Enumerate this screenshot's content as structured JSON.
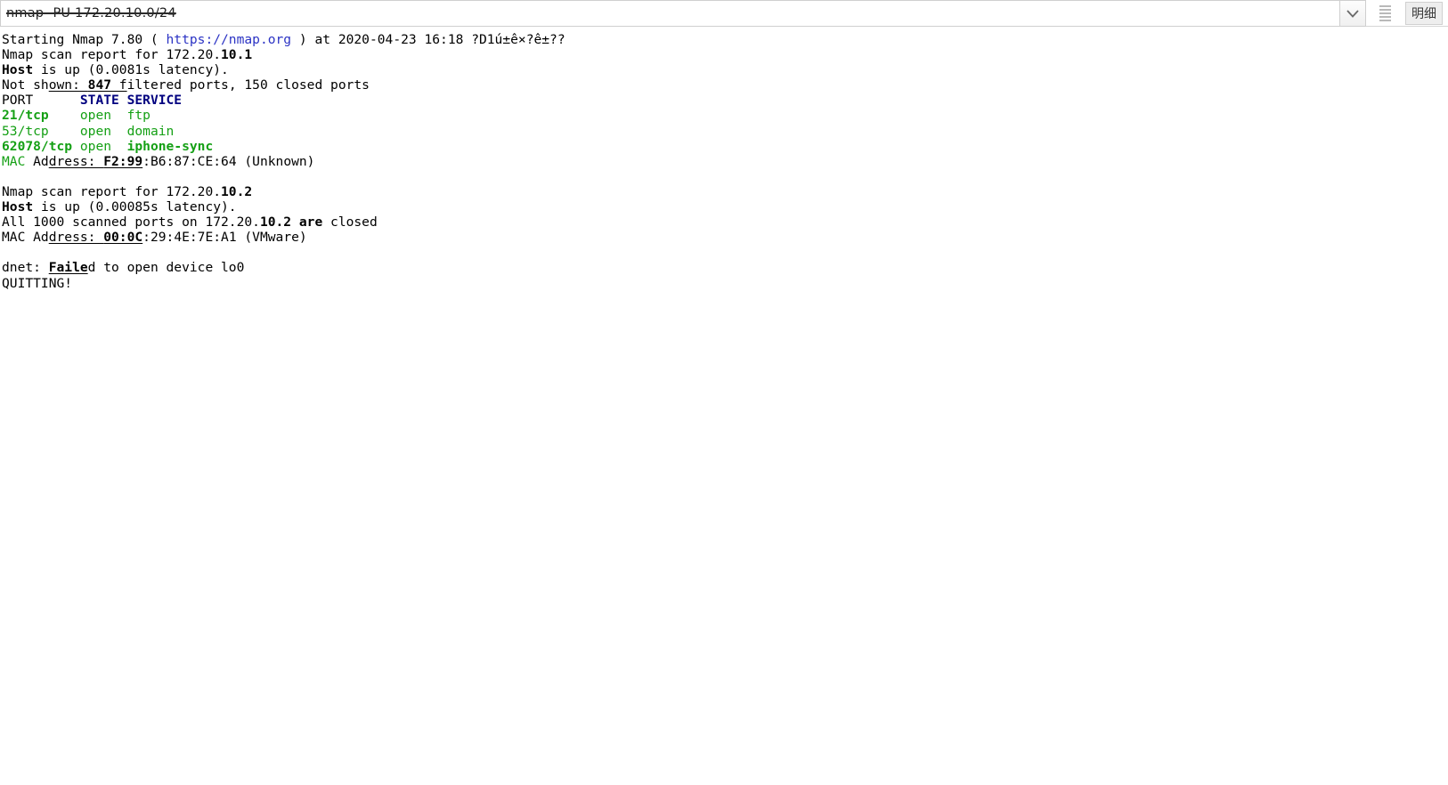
{
  "topbar": {
    "command_value": "nmap -PU 172.20.10.0/24",
    "command_placeholder": "",
    "dropdown_icon": "chevron-down-icon",
    "lines_icon": "list-lines-icon",
    "detail_button_label": "明细"
  },
  "terminal": {
    "lines": [
      {
        "id": "line-starting",
        "segments": [
          {
            "t": "Starting Nmap 7.80 ( ",
            "c": ""
          },
          {
            "t": "https://nmap.org",
            "c": "link"
          },
          {
            "t": " ) at 2020-04-23 16:18 ?D1ú±ê×?ê±??",
            "c": ""
          }
        ]
      },
      {
        "id": "line-report-1",
        "segments": [
          {
            "t": "Nmap scan report for 172.20.",
            "c": ""
          },
          {
            "t": "10.1",
            "c": "b"
          }
        ]
      },
      {
        "id": "line-host-up-1",
        "segments": [
          {
            "t": "Host",
            "c": "b"
          },
          {
            "t": " is up (0.0081s latency).",
            "c": ""
          }
        ]
      },
      {
        "id": "line-not-shown",
        "segments": [
          {
            "t": "Not sh",
            "c": ""
          },
          {
            "t": "own: ",
            "c": "u"
          },
          {
            "t": "847",
            "c": "b u"
          },
          {
            "t": " f",
            "c": "u"
          },
          {
            "t": "iltered ports, 150 closed ports",
            "c": ""
          }
        ]
      },
      {
        "id": "line-port-header",
        "segments": [
          {
            "t": "PORT      ",
            "c": ""
          },
          {
            "t": "STATE SERVICE",
            "c": "hdr"
          }
        ]
      },
      {
        "id": "line-port-21",
        "segments": [
          {
            "t": "21/tcp",
            "c": "grnb"
          },
          {
            "t": "    ",
            "c": ""
          },
          {
            "t": "open",
            "c": "grn"
          },
          {
            "t": "  ",
            "c": ""
          },
          {
            "t": "ftp",
            "c": "grn"
          }
        ]
      },
      {
        "id": "line-port-53",
        "segments": [
          {
            "t": "53/tcp",
            "c": "grn"
          },
          {
            "t": "    ",
            "c": ""
          },
          {
            "t": "open",
            "c": "grn"
          },
          {
            "t": "  ",
            "c": ""
          },
          {
            "t": "domain",
            "c": "grn"
          }
        ]
      },
      {
        "id": "line-port-62078",
        "segments": [
          {
            "t": "62078/tcp",
            "c": "grnb"
          },
          {
            "t": " ",
            "c": ""
          },
          {
            "t": "open",
            "c": "grn"
          },
          {
            "t": "  ",
            "c": ""
          },
          {
            "t": "iphone-sync",
            "c": "grnb"
          }
        ]
      },
      {
        "id": "line-mac-1",
        "segments": [
          {
            "t": "MAC",
            "c": "grn"
          },
          {
            "t": " Ad",
            "c": ""
          },
          {
            "t": "dress: ",
            "c": "u"
          },
          {
            "t": "F2:99",
            "c": "b u"
          },
          {
            "t": ":B6:87:CE:64 (Unknown)",
            "c": ""
          }
        ]
      },
      {
        "id": "blank-1",
        "segments": []
      },
      {
        "id": "line-report-2",
        "segments": [
          {
            "t": "Nmap scan report for 172.20.",
            "c": ""
          },
          {
            "t": "10.2",
            "c": "b"
          }
        ]
      },
      {
        "id": "line-host-up-2",
        "segments": [
          {
            "t": "Host",
            "c": "b"
          },
          {
            "t": " is up (0.00085s latency).",
            "c": ""
          }
        ]
      },
      {
        "id": "line-all-closed",
        "segments": [
          {
            "t": "All 1000 scanned ports on 172.20.",
            "c": ""
          },
          {
            "t": "10.2 are",
            "c": "b"
          },
          {
            "t": " closed",
            "c": ""
          }
        ]
      },
      {
        "id": "line-mac-2",
        "segments": [
          {
            "t": "MAC Ad",
            "c": ""
          },
          {
            "t": "dress: ",
            "c": "u"
          },
          {
            "t": "00:0C",
            "c": "b u"
          },
          {
            "t": ":29:4E:7E:A1 (VMware)",
            "c": ""
          }
        ]
      },
      {
        "id": "blank-2",
        "segments": []
      },
      {
        "id": "line-dnet-failed",
        "segments": [
          {
            "t": "dnet: ",
            "c": ""
          },
          {
            "t": "Faile",
            "c": "b u"
          },
          {
            "t": "d to open device lo0",
            "c": ""
          }
        ]
      },
      {
        "id": "line-quitting",
        "segments": [
          {
            "t": "QUITTING!",
            "c": ""
          }
        ]
      }
    ]
  },
  "colors": {
    "link": "#2b33c4",
    "header": "#00007f",
    "open_port": "#15a015",
    "text": "#000000",
    "topbar_border": "#cfcfcf",
    "button_face": "#eeeeee"
  }
}
